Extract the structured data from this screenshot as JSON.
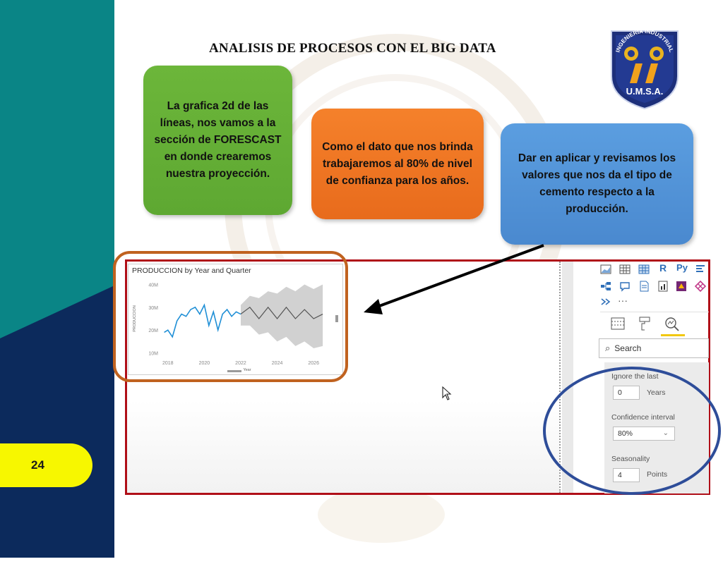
{
  "slide": {
    "title": "ANALISIS DE PROCESOS CON EL BIG DATA",
    "page_number": "24"
  },
  "logo": {
    "ring_text": "INGENIERIA INDUSTRIAL",
    "acronym": "U.M.S.A."
  },
  "callouts": {
    "green": "La grafica 2d de las líneas, nos vamos a la sección de FORESCAST en donde crearemos nuestra proyección.",
    "orange": "Como el dato que nos brinda trabajaremos al 80% de nivel de confianza para los años.",
    "blue": "Dar en aplicar y revisamos los valores que nos da el tipo de cemento respecto a la producción."
  },
  "colors": {
    "teal": "#0a8586",
    "navy": "#0c2a5c",
    "badge_yellow": "#f7f700",
    "frame_red": "#b00f18",
    "highlight_orange": "#c0621f",
    "circle_blue": "#2e4d99",
    "line_blue": "#1f8fd6",
    "forecast_gray": "#c9c9c9"
  },
  "chart_data": {
    "type": "line",
    "title": "PRODUCCION by Year and Quarter",
    "xlabel": "Year",
    "ylabel": "PRODUCCION",
    "x_ticks": [
      "2018",
      "2020",
      "2022",
      "2024",
      "2026"
    ],
    "y_ticks": [
      "10M",
      "20M",
      "30M",
      "40M"
    ],
    "xlim": [
      2017.7,
      2027.0
    ],
    "ylim": [
      8,
      42
    ],
    "series": [
      {
        "role": "actual",
        "x": [
          2017.8,
          2018.0,
          2018.25,
          2018.5,
          2018.75,
          2019.0,
          2019.25,
          2019.5,
          2019.75,
          2020.0,
          2020.25,
          2020.5,
          2020.75,
          2021.0,
          2021.25,
          2021.5,
          2021.75,
          2022.0
        ],
        "y": [
          19,
          20,
          17,
          24,
          27,
          26,
          29,
          30,
          27,
          31,
          22,
          28,
          20,
          27,
          29,
          26,
          28,
          27
        ]
      },
      {
        "role": "forecast",
        "x": [
          2022.0,
          2022.5,
          2023.0,
          2023.5,
          2024.0,
          2024.5,
          2025.0,
          2025.5,
          2026.0,
          2026.5
        ],
        "y": [
          27,
          30,
          25,
          30,
          25,
          30,
          25,
          29,
          25,
          27
        ],
        "lower": [
          22,
          22,
          18,
          19,
          15,
          17,
          13,
          15,
          12,
          13
        ],
        "upper": [
          31,
          35,
          34,
          37,
          36,
          39,
          37,
          40,
          38,
          40
        ]
      }
    ],
    "grid": false,
    "legend": "none"
  },
  "pane": {
    "search_placeholder": "Search",
    "ignore_label": "Ignore the last",
    "ignore_value": "0",
    "ignore_unit": "Years",
    "confidence_label": "Confidence interval",
    "confidence_value": "80%",
    "seasonality_label": "Seasonality",
    "seasonality_value": "4",
    "seasonality_unit": "Points",
    "icons": [
      "stacked-area-icon",
      "table-icon",
      "matrix-icon",
      "r-visual-icon",
      "python-visual-icon",
      "key-influencers-icon",
      "decomposition-tree-icon",
      "qa-icon",
      "smart-narrative-icon",
      "paginated-report-icon",
      "power-apps-icon",
      "power-automate-icon",
      "more-visuals-icon",
      "ellipsis-icon",
      "fields-icon",
      "format-icon",
      "analytics-icon"
    ]
  }
}
